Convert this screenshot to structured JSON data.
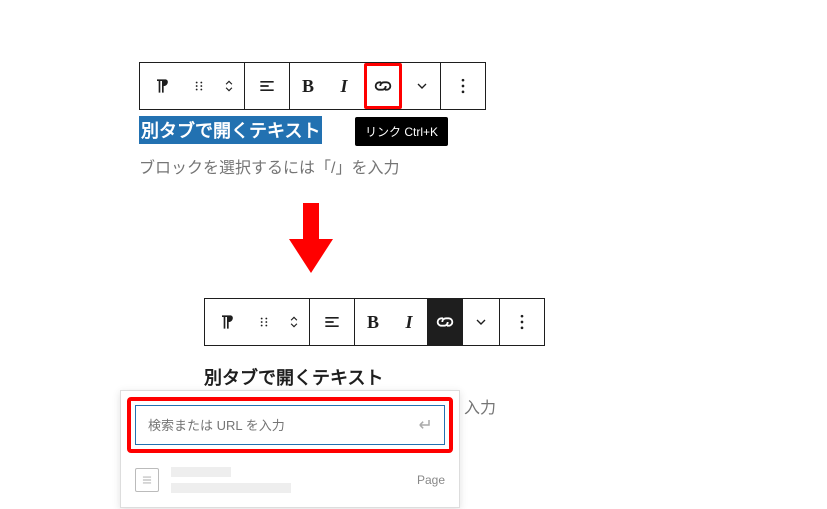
{
  "scene1": {
    "toolbar": {
      "bold": "B",
      "italic": "I"
    },
    "selected_text": "別タブで開くテキスト",
    "placeholder_line": "ブロックを選択するには「/」を入力",
    "tooltip": "リンク  Ctrl+K"
  },
  "scene2": {
    "toolbar": {
      "bold": "B",
      "italic": "I"
    },
    "text": "別タブで開くテキスト",
    "placeholder_tail": "入力",
    "popover": {
      "url_placeholder": "検索または URL を入力",
      "suggestion_type": "Page"
    }
  }
}
